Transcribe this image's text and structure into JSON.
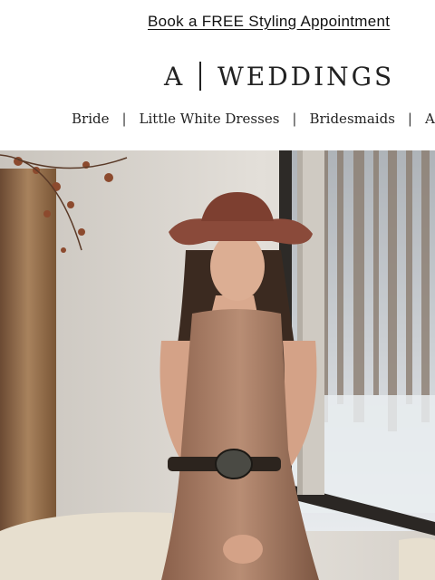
{
  "promo": {
    "link": "Book a FREE Styling Appointment"
  },
  "logo": {
    "mark": "A",
    "brand": "WEDDINGS"
  },
  "nav": {
    "items": [
      {
        "label": "Bride"
      },
      {
        "label": "Little White Dresses"
      },
      {
        "label": "Bridesmaids"
      },
      {
        "label": "Accessories"
      }
    ]
  },
  "hero": {
    "image": "model-in-sequin-dress-and-cowboy-hat"
  },
  "colors": {
    "text": "#111111",
    "hat": "#8a4a3a",
    "dress": "#a47660"
  }
}
